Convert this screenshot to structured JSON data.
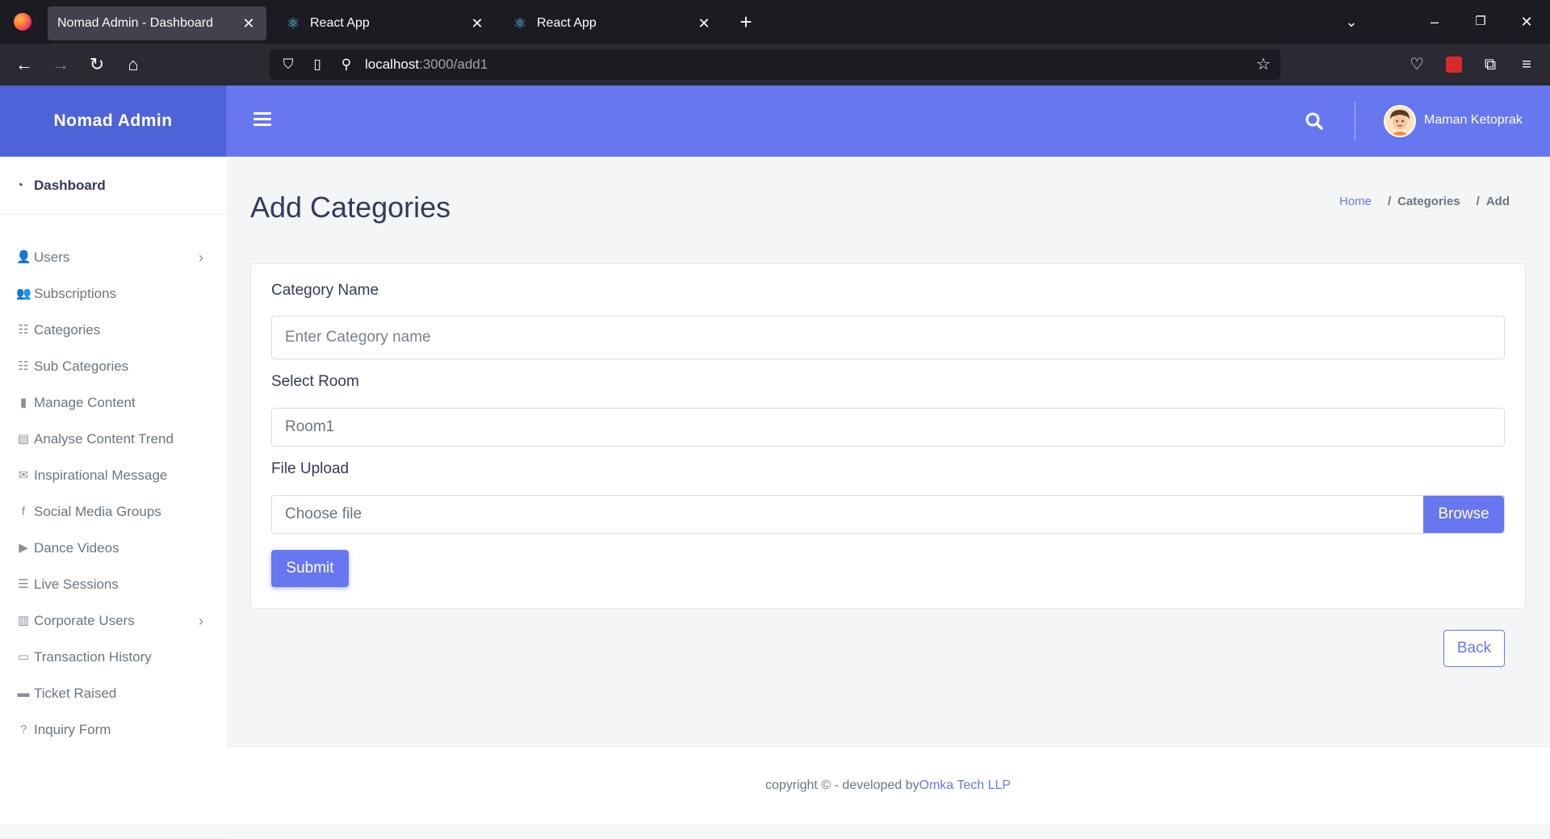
{
  "browser": {
    "tabs": [
      {
        "title": "Nomad Admin - Dashboard",
        "active": true
      },
      {
        "title": "React App",
        "active": false
      },
      {
        "title": "React App",
        "active": false
      }
    ],
    "url_host": "localhost",
    "url_path": ":3000/add1"
  },
  "brand": "Nomad Admin",
  "topbar": {
    "username": "Maman Ketoprak"
  },
  "sidebar": {
    "dashboard": "Dashboard",
    "items": [
      {
        "label": "Users",
        "icon": "user-icon",
        "glyph": "👤",
        "has_submenu": true
      },
      {
        "label": "Subscriptions",
        "icon": "user-plus-icon",
        "glyph": "👥",
        "has_submenu": false
      },
      {
        "label": "Categories",
        "icon": "list-icon",
        "glyph": "☷",
        "has_submenu": false
      },
      {
        "label": "Sub Categories",
        "icon": "list-icon",
        "glyph": "☷",
        "has_submenu": false
      },
      {
        "label": "Manage Content",
        "icon": "file-icon",
        "glyph": "▮",
        "has_submenu": false
      },
      {
        "label": "Analyse Content Trend",
        "icon": "chart-icon",
        "glyph": "▤",
        "has_submenu": false
      },
      {
        "label": "Inspirational Message",
        "icon": "envelope-icon",
        "glyph": "✉",
        "has_submenu": false
      },
      {
        "label": "Social Media Groups",
        "icon": "facebook-icon",
        "glyph": "f",
        "has_submenu": false
      },
      {
        "label": "Dance Videos",
        "icon": "play-circle-icon",
        "glyph": "▶",
        "has_submenu": false
      },
      {
        "label": "Live Sessions",
        "icon": "bars-icon",
        "glyph": "☰",
        "has_submenu": false
      },
      {
        "label": "Corporate Users",
        "icon": "building-icon",
        "glyph": "▥",
        "has_submenu": true
      },
      {
        "label": "Transaction History",
        "icon": "credit-card-icon",
        "glyph": "▭",
        "has_submenu": false
      },
      {
        "label": "Ticket Raised",
        "icon": "ticket-icon",
        "glyph": "▬",
        "has_submenu": false
      },
      {
        "label": "Inquiry Form",
        "icon": "question-circle-icon",
        "glyph": "?",
        "has_submenu": false
      }
    ]
  },
  "page": {
    "title": "Add Categories",
    "breadcrumb": {
      "home": "Home",
      "section": "Categories",
      "current": "Add"
    }
  },
  "form": {
    "category_label": "Category Name",
    "category_placeholder": "Enter Category name",
    "room_label": "Select Room",
    "room_value": "Room1",
    "file_label": "File Upload",
    "file_placeholder": "Choose file",
    "browse_label": "Browse",
    "submit_label": "Submit"
  },
  "back_label": "Back",
  "footer": {
    "text": "copyright © - developed by",
    "link": "Omka Tech LLP"
  },
  "colors": {
    "primary": "#6777ef",
    "brand_bg": "#4e63d7"
  }
}
